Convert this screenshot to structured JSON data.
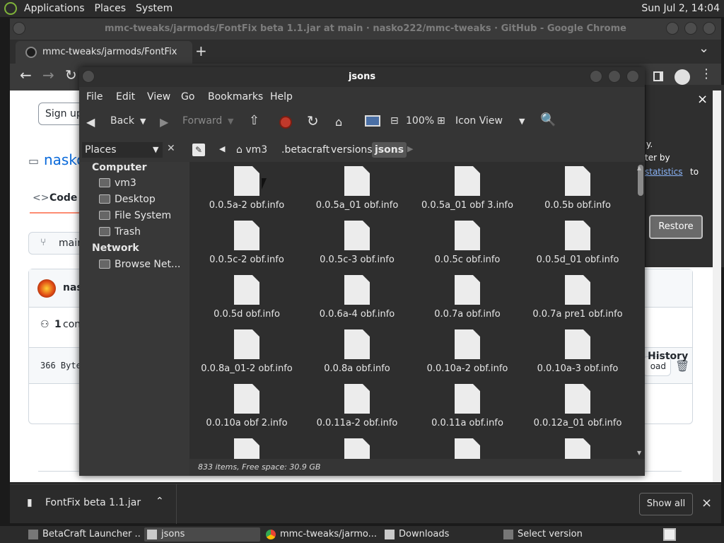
{
  "top_panel": {
    "menus": [
      "Applications",
      "Places",
      "System"
    ],
    "clock": "Sun Jul  2, 14:04"
  },
  "chrome": {
    "window_title": "mmc-tweaks/jarmods/FontFix beta 1.1.jar at main · nasko222/mmc-tweaks · GitHub - Google Chrome",
    "tab_title": "mmc-tweaks/jarmods/FontFix",
    "new_tab": "+",
    "tab_search": "⌄"
  },
  "github": {
    "signup": "Sign up",
    "repo_name": "nasko",
    "code_tab": "Code",
    "branch": "main",
    "commit_author": "nas",
    "contributors_count": "1",
    "contributors_label": "con",
    "history": "History",
    "file_size": "366 Byte",
    "download": "oad"
  },
  "notice": {
    "line1": "y.",
    "line2": "ter by",
    "link": "statistics",
    "line_after": "to",
    "restore": "Restore",
    "close": "×"
  },
  "downloads_bar": {
    "file": "FontFix beta 1.1.jar",
    "show_all": "Show all",
    "close": "×"
  },
  "taskbar": {
    "items": [
      "BetaCraft Launcher ...",
      "jsons",
      "mmc-tweaks/jarmo...",
      "Downloads",
      "Select version"
    ]
  },
  "nemo": {
    "title": "jsons",
    "menus": [
      "File",
      "Edit",
      "View",
      "Go",
      "Bookmarks",
      "Help"
    ],
    "toolbar": {
      "back": "Back",
      "forward": "Forward",
      "zoom": "100%",
      "view_mode": "Icon View"
    },
    "places_label": "Places",
    "breadcrumbs": [
      "vm3",
      ".betacraft",
      "versions",
      "jsons"
    ],
    "sidebar": {
      "computer_head": "Computer",
      "computer_items": [
        "vm3",
        "Desktop",
        "File System",
        "Trash"
      ],
      "network_head": "Network",
      "network_items": [
        "Browse Net..."
      ]
    },
    "files": [
      "0.0.5a-2 obf.info",
      "0.0.5a_01 obf.info",
      "0.0.5a_01 obf 3.info",
      "0.0.5b obf.info",
      "0.0.5c-2 obf.info",
      "0.0.5c-3 obf.info",
      "0.0.5c obf.info",
      "0.0.5d_01 obf.info",
      "0.0.5d obf.info",
      "0.0.6a-4 obf.info",
      "0.0.7a obf.info",
      "0.0.7a pre1 obf.info",
      "0.0.8a_01-2 obf.info",
      "0.0.8a obf.info",
      "0.0.10a-2 obf.info",
      "0.0.10a-3 obf.info",
      "0.0.10a obf 2.info",
      "0.0.11a-2 obf.info",
      "0.0.11a obf.info",
      "0.0.12a_01 obf.info",
      "",
      "",
      "",
      ""
    ],
    "status": "833 items, Free space: 30.9 GB"
  }
}
